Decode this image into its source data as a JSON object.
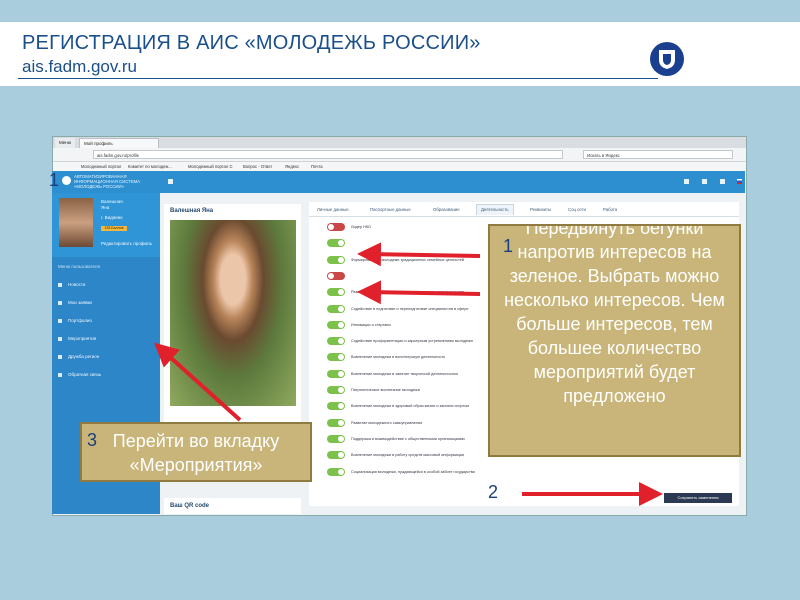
{
  "slide": {
    "title": "РЕГИСТРАЦИЯ В АИС «МОЛОДЕЖЬ РОССИИ»",
    "subtitle": "ais.fadm.gov.ru"
  },
  "browser": {
    "tabs": [
      "Меню",
      "Мой профиль"
    ],
    "address": "ais.fadm.gov.ru/profile",
    "search_placeholder": "Искать в Яндекс",
    "bookmarks": [
      "Молодежный портал",
      "Комитет по молодеж...",
      "Молодежный портал С",
      "Вопрос - Ответ",
      "Яндекс",
      "Почта"
    ]
  },
  "app": {
    "name_line1": "АВТОМАТИЗИРОВАННАЯ",
    "name_line2": "ИНФОРМАЦИОННАЯ СИСТЕМА",
    "name_line3": "«МОЛОДЕЖЬ РОССИИ»",
    "user_name_line1": "Валешная",
    "user_name_line2": "Яна",
    "user_city": "г. Видяево",
    "user_badge": "153 Баллов",
    "edit_profile": "Редактировать профиль",
    "nav_section": "Меню пользователя",
    "nav": [
      "Новости",
      "Мои заявки",
      "Портфолио",
      "Мероприятия",
      "Дружба регион",
      "Обратная связь"
    ],
    "profile_heading": "Валешная Яна",
    "qr_heading": "Ваш QR code",
    "tabs": [
      "Личные данные",
      "Паспортные данные",
      "Образование",
      "Деятельность",
      "Реквизиты",
      "Соц сети",
      "Работа"
    ],
    "interests": [
      {
        "label": "Лидер НКО",
        "on": false
      },
      {
        "label": "",
        "on": true
      },
      {
        "label": "Формирование у молодежи традиционных семейных ценностей",
        "on": true
      },
      {
        "label": "",
        "on": false
      },
      {
        "label": "Развитие международного и межрегионального сотрудничества",
        "on": true
      },
      {
        "label": "Содействие в подготовке и переподготовке специалистов в сфере",
        "on": true
      },
      {
        "label": "Инновации и стартапы",
        "on": true
      },
      {
        "label": "Содействие профориентации и карьерным устремлениям молодежи",
        "on": true
      },
      {
        "label": "Вовлечение молодежи в волонтерскую деятельность",
        "on": true
      },
      {
        "label": "Вовлечение молодежи в занятие творческой деятельностью",
        "on": true
      },
      {
        "label": "Патриотическое воспитание молодежи",
        "on": true
      },
      {
        "label": "Вовлечение молодежи в здоровый образ жизни и занятия спортом",
        "on": true
      },
      {
        "label": "Развитие молодежного самоуправления",
        "on": true
      },
      {
        "label": "Поддержка и взаимодействие с общественными организациями",
        "on": true
      },
      {
        "label": "Вовлечение молодежи в работу средств массовой информации",
        "on": true
      },
      {
        "label": "Социализация молодежи, нуждающейся в особой заботе государства",
        "on": true
      }
    ],
    "save_button": "Сохранить изменения"
  },
  "annotations": {
    "num1": "1",
    "num2": "2",
    "num3": "3",
    "callout1": "Передвинуть бегунки напротив интересов на зеленое. Выбрать можно несколько интересов. Чем больше интересов, тем большее количество мероприятий будет предложено",
    "callout3": "Перейти во вкладку «Мероприятия»"
  },
  "colors": {
    "app_blue": "#2d8fd0",
    "toggle_on": "#7cc24a",
    "toggle_off": "#c94747",
    "arrow": "#e0202a",
    "callout": "#c9b57a"
  }
}
